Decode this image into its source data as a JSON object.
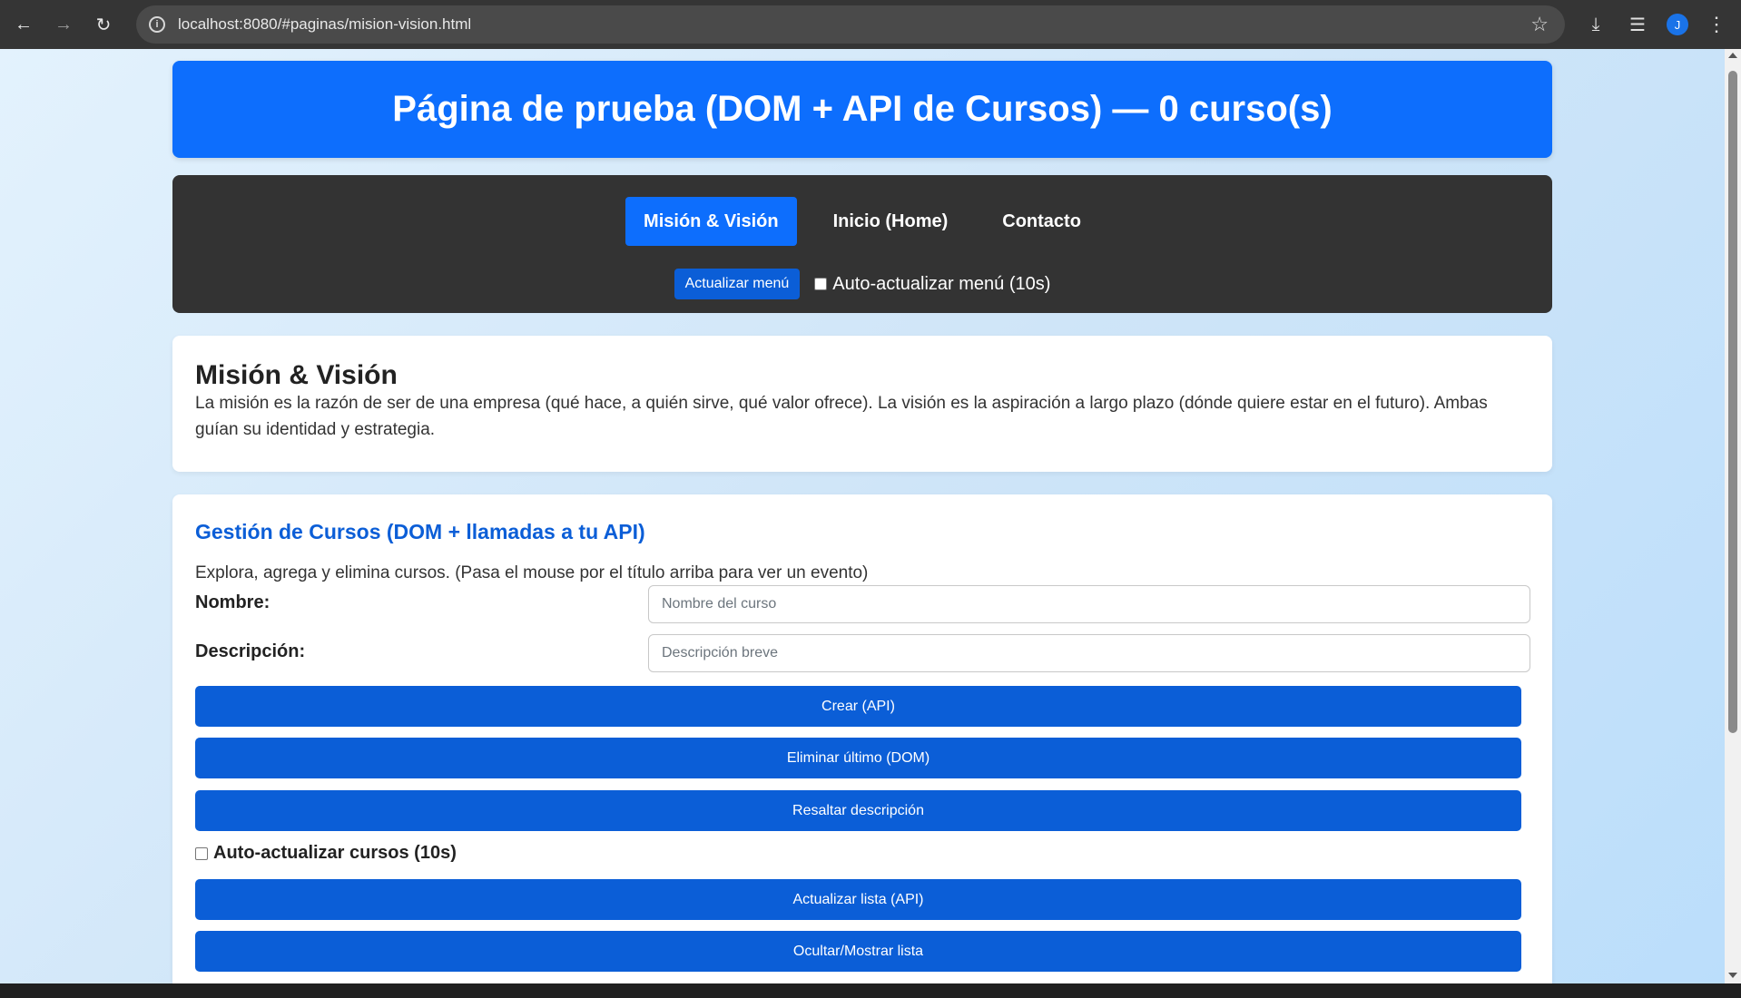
{
  "browser": {
    "url": "localhost:8080/#paginas/mision-vision.html",
    "profile_initial": "J",
    "icons": [
      "back-arrow-icon",
      "forward-arrow-icon",
      "reload-icon",
      "site-info-icon",
      "bookmark-star-icon",
      "download-icon",
      "reading-list-icon",
      "kebab-menu-icon"
    ]
  },
  "header": {
    "title": "Página de prueba (DOM + API de Cursos) — 0 curso(s)"
  },
  "menu": {
    "links": [
      {
        "label": "Misión & Visión",
        "active": true
      },
      {
        "label": "Inicio (Home)",
        "active": false
      },
      {
        "label": "Contacto",
        "active": false
      }
    ],
    "refresh_button": "Actualizar menú",
    "auto_refresh_label": "Auto-actualizar menú (10s)"
  },
  "mission": {
    "title": "Misión & Visión",
    "text": "La misión es la razón de ser de una empresa (qué hace, a quién sirve, qué valor ofrece). La visión es la aspiración a largo plazo (dónde quiere estar en el futuro). Ambas guían su identidad y estrategia."
  },
  "courses": {
    "title": "Gestión de Cursos (DOM + llamadas a tu API)",
    "description": "Explora, agrega y elimina cursos. (Pasa el mouse por el título arriba para ver un evento)",
    "name_label": "Nombre:",
    "name_placeholder": "Nombre del curso",
    "desc_label": "Descripción:",
    "desc_placeholder": "Descripción breve",
    "create_button": "Crear (API)",
    "delete_last_button": "Eliminar último (DOM)",
    "highlight_button": "Resaltar descripción",
    "auto_refresh_label": "Auto-actualizar cursos (10s)",
    "refresh_list_button": "Actualizar lista (API)",
    "toggle_list_button": "Ocultar/Mostrar lista"
  },
  "colors": {
    "primary": "#0d6efd",
    "button": "#0b5ed7",
    "menu_bg": "#333333"
  }
}
